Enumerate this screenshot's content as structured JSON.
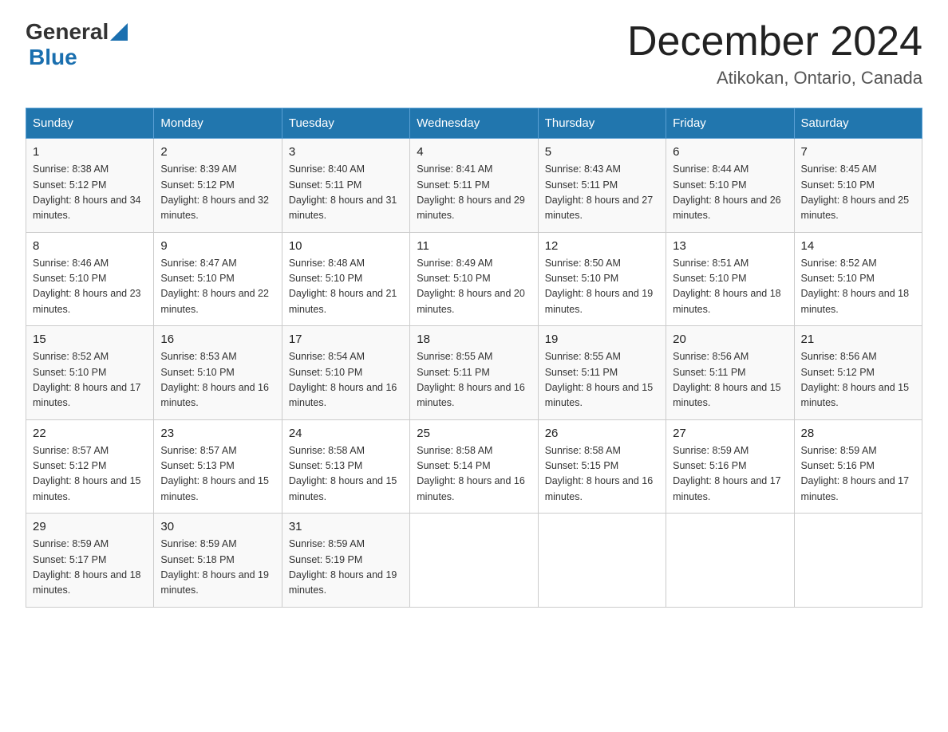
{
  "header": {
    "logo_general": "General",
    "logo_blue": "Blue",
    "month_title": "December 2024",
    "location": "Atikokan, Ontario, Canada"
  },
  "days_of_week": [
    "Sunday",
    "Monday",
    "Tuesday",
    "Wednesday",
    "Thursday",
    "Friday",
    "Saturday"
  ],
  "weeks": [
    [
      {
        "day": "1",
        "sunrise": "8:38 AM",
        "sunset": "5:12 PM",
        "daylight": "8 hours and 34 minutes."
      },
      {
        "day": "2",
        "sunrise": "8:39 AM",
        "sunset": "5:12 PM",
        "daylight": "8 hours and 32 minutes."
      },
      {
        "day": "3",
        "sunrise": "8:40 AM",
        "sunset": "5:11 PM",
        "daylight": "8 hours and 31 minutes."
      },
      {
        "day": "4",
        "sunrise": "8:41 AM",
        "sunset": "5:11 PM",
        "daylight": "8 hours and 29 minutes."
      },
      {
        "day": "5",
        "sunrise": "8:43 AM",
        "sunset": "5:11 PM",
        "daylight": "8 hours and 27 minutes."
      },
      {
        "day": "6",
        "sunrise": "8:44 AM",
        "sunset": "5:10 PM",
        "daylight": "8 hours and 26 minutes."
      },
      {
        "day": "7",
        "sunrise": "8:45 AM",
        "sunset": "5:10 PM",
        "daylight": "8 hours and 25 minutes."
      }
    ],
    [
      {
        "day": "8",
        "sunrise": "8:46 AM",
        "sunset": "5:10 PM",
        "daylight": "8 hours and 23 minutes."
      },
      {
        "day": "9",
        "sunrise": "8:47 AM",
        "sunset": "5:10 PM",
        "daylight": "8 hours and 22 minutes."
      },
      {
        "day": "10",
        "sunrise": "8:48 AM",
        "sunset": "5:10 PM",
        "daylight": "8 hours and 21 minutes."
      },
      {
        "day": "11",
        "sunrise": "8:49 AM",
        "sunset": "5:10 PM",
        "daylight": "8 hours and 20 minutes."
      },
      {
        "day": "12",
        "sunrise": "8:50 AM",
        "sunset": "5:10 PM",
        "daylight": "8 hours and 19 minutes."
      },
      {
        "day": "13",
        "sunrise": "8:51 AM",
        "sunset": "5:10 PM",
        "daylight": "8 hours and 18 minutes."
      },
      {
        "day": "14",
        "sunrise": "8:52 AM",
        "sunset": "5:10 PM",
        "daylight": "8 hours and 18 minutes."
      }
    ],
    [
      {
        "day": "15",
        "sunrise": "8:52 AM",
        "sunset": "5:10 PM",
        "daylight": "8 hours and 17 minutes."
      },
      {
        "day": "16",
        "sunrise": "8:53 AM",
        "sunset": "5:10 PM",
        "daylight": "8 hours and 16 minutes."
      },
      {
        "day": "17",
        "sunrise": "8:54 AM",
        "sunset": "5:10 PM",
        "daylight": "8 hours and 16 minutes."
      },
      {
        "day": "18",
        "sunrise": "8:55 AM",
        "sunset": "5:11 PM",
        "daylight": "8 hours and 16 minutes."
      },
      {
        "day": "19",
        "sunrise": "8:55 AM",
        "sunset": "5:11 PM",
        "daylight": "8 hours and 15 minutes."
      },
      {
        "day": "20",
        "sunrise": "8:56 AM",
        "sunset": "5:11 PM",
        "daylight": "8 hours and 15 minutes."
      },
      {
        "day": "21",
        "sunrise": "8:56 AM",
        "sunset": "5:12 PM",
        "daylight": "8 hours and 15 minutes."
      }
    ],
    [
      {
        "day": "22",
        "sunrise": "8:57 AM",
        "sunset": "5:12 PM",
        "daylight": "8 hours and 15 minutes."
      },
      {
        "day": "23",
        "sunrise": "8:57 AM",
        "sunset": "5:13 PM",
        "daylight": "8 hours and 15 minutes."
      },
      {
        "day": "24",
        "sunrise": "8:58 AM",
        "sunset": "5:13 PM",
        "daylight": "8 hours and 15 minutes."
      },
      {
        "day": "25",
        "sunrise": "8:58 AM",
        "sunset": "5:14 PM",
        "daylight": "8 hours and 16 minutes."
      },
      {
        "day": "26",
        "sunrise": "8:58 AM",
        "sunset": "5:15 PM",
        "daylight": "8 hours and 16 minutes."
      },
      {
        "day": "27",
        "sunrise": "8:59 AM",
        "sunset": "5:16 PM",
        "daylight": "8 hours and 17 minutes."
      },
      {
        "day": "28",
        "sunrise": "8:59 AM",
        "sunset": "5:16 PM",
        "daylight": "8 hours and 17 minutes."
      }
    ],
    [
      {
        "day": "29",
        "sunrise": "8:59 AM",
        "sunset": "5:17 PM",
        "daylight": "8 hours and 18 minutes."
      },
      {
        "day": "30",
        "sunrise": "8:59 AM",
        "sunset": "5:18 PM",
        "daylight": "8 hours and 19 minutes."
      },
      {
        "day": "31",
        "sunrise": "8:59 AM",
        "sunset": "5:19 PM",
        "daylight": "8 hours and 19 minutes."
      },
      null,
      null,
      null,
      null
    ]
  ]
}
